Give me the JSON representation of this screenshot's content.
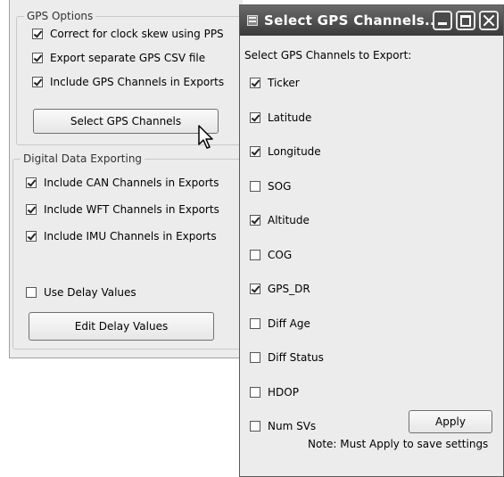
{
  "settings_panel": {
    "gps_group": {
      "legend": "GPS Options",
      "options": [
        {
          "label": "Correct for clock skew using PPS",
          "checked": true
        },
        {
          "label": "Export separate GPS CSV file",
          "checked": true
        },
        {
          "label": "Include GPS Channels in Exports",
          "checked": true
        }
      ],
      "select_button": "Select GPS Channels"
    },
    "digital_group": {
      "legend": "Digital Data Exporting",
      "options": [
        {
          "label": "Include CAN Channels in Exports",
          "checked": true
        },
        {
          "label": "Include WFT Channels in Exports",
          "checked": true
        },
        {
          "label": "Include IMU Channels in Exports",
          "checked": true
        }
      ],
      "delay_option": {
        "label": "Use Delay Values",
        "checked": false
      },
      "edit_button": "Edit Delay Values"
    }
  },
  "dialog": {
    "title": "Select GPS Channels...",
    "heading": "Select GPS Channels to Export:",
    "channels": [
      {
        "label": "Ticker",
        "checked": true
      },
      {
        "label": "Latitude",
        "checked": true
      },
      {
        "label": "Longitude",
        "checked": true
      },
      {
        "label": "SOG",
        "checked": false
      },
      {
        "label": "Altitude",
        "checked": true
      },
      {
        "label": "COG",
        "checked": false
      },
      {
        "label": "GPS_DR",
        "checked": true
      },
      {
        "label": "Diff Age",
        "checked": false
      },
      {
        "label": "Diff Status",
        "checked": false
      },
      {
        "label": "HDOP",
        "checked": false
      },
      {
        "label": "Num SVs",
        "checked": false
      }
    ],
    "apply_button": "Apply",
    "note": "Note: Must Apply to save settings"
  },
  "icons": [
    "dialog-window-icon",
    "minimize-icon",
    "maximize-icon",
    "close-icon",
    "mouse-pointer-icon"
  ]
}
